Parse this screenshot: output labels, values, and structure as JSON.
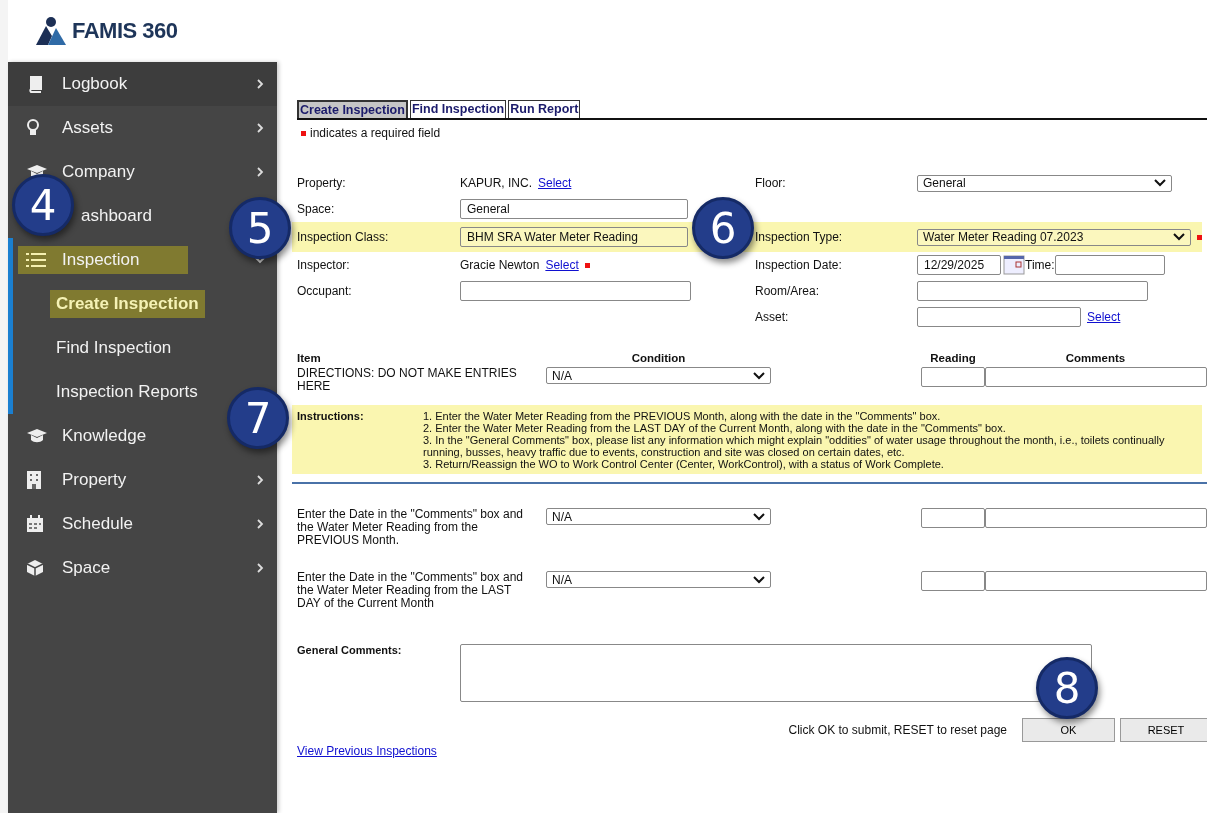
{
  "logo": {
    "text": "FAMIS 360"
  },
  "sidebar": {
    "items": [
      {
        "label": "Logbook",
        "chevron": true,
        "expanded": false,
        "selected": false
      },
      {
        "label": "Assets",
        "chevron": true,
        "expanded": false,
        "selected": false
      },
      {
        "label": "Company",
        "chevron": true,
        "expanded": false,
        "selected": false
      },
      {
        "label": "ashboard",
        "chevron": false,
        "selected": false
      },
      {
        "label": "Inspection",
        "chevron": true,
        "expanded": true,
        "selected": true,
        "children": [
          {
            "label": "Create Inspection",
            "selected": true
          },
          {
            "label": "Find Inspection",
            "selected": false
          },
          {
            "label": "Inspection Reports",
            "selected": false
          }
        ]
      },
      {
        "label": "Knowledge",
        "chevron": false,
        "selected": false
      },
      {
        "label": "Property",
        "chevron": true,
        "expanded": false,
        "selected": false
      },
      {
        "label": "Schedule",
        "chevron": true,
        "expanded": false,
        "selected": false
      },
      {
        "label": "Space",
        "chevron": true,
        "expanded": false,
        "selected": false
      }
    ]
  },
  "tabs": [
    {
      "label": "Create Inspection",
      "selected": true
    },
    {
      "label": "Find Inspection",
      "selected": false
    },
    {
      "label": "Run Report",
      "selected": false
    }
  ],
  "required_note": "indicates a required field",
  "form": {
    "rows": [
      {
        "left": {
          "label": "Property:",
          "kind": "text",
          "value": "KAPUR, INC.",
          "link": "Select"
        },
        "right": {
          "label": "Floor:",
          "kind": "select",
          "value": "General"
        }
      },
      {
        "left": {
          "label": "Space:",
          "kind": "input",
          "value": "General"
        },
        "right": null
      },
      {
        "highlighted": true,
        "left": {
          "label": "Inspection Class:",
          "kind": "input",
          "value": "BHM SRA Water Meter Reading"
        },
        "right": {
          "label": "Inspection Type:",
          "kind": "select",
          "value": "Water Meter Reading 07.2023",
          "required": true
        }
      },
      {
        "left": {
          "label": "Inspector:",
          "kind": "text",
          "value": "Gracie Newton",
          "link": "Select",
          "required": true
        },
        "right": {
          "label": "Inspection Date:",
          "kind": "date",
          "value": "12/29/2025",
          "time_label": "Time:"
        }
      },
      {
        "left": {
          "label": "Occupant:",
          "kind": "input"
        },
        "right": {
          "label": "Room/Area:",
          "kind": "input"
        }
      },
      {
        "left": null,
        "right": {
          "label": "Asset:",
          "kind": "input",
          "link": "Select"
        }
      }
    ]
  },
  "checklist": {
    "columns": [
      "Item",
      "Condition",
      "Reading",
      "Comments"
    ],
    "rows": [
      {
        "kind": "item",
        "item": "DIRECTIONS: DO NOT MAKE ENTRIES HERE",
        "condition": "N/A"
      },
      {
        "kind": "instructions",
        "label": "Instructions:",
        "lines": [
          "1. Enter the Water Meter Reading from the PREVIOUS Month, along with the date in the \"Comments\" box.",
          "2. Enter the Water Meter Reading from the LAST DAY of the Current Month, along with the date in the \"Comments\" box.",
          "3. In the \"General Comments\" box, please list any information which might explain \"oddities\" of water usage throughout the month, i.e., toilets continually running, busses, heavy traffic due to events, construction and site was closed on certain dates, etc.",
          "3. Return/Reassign the WO to Work Control Center (Center, WorkControl), with a status of Work Complete."
        ]
      },
      {
        "kind": "item",
        "item": "Enter the Date in the \"Comments\" box and the Water Meter Reading from the PREVIOUS Month.",
        "condition": "N/A"
      },
      {
        "kind": "item",
        "item": "Enter the Date in the \"Comments\" box and the Water Meter Reading from the LAST DAY of the Current Month",
        "condition": "N/A"
      }
    ]
  },
  "general_comments": {
    "label": "General Comments:"
  },
  "footer": {
    "hint": "Click OK to submit, RESET to reset page",
    "buttons": [
      "OK",
      "RESET"
    ],
    "link": "View Previous Inspections"
  },
  "callouts": [
    {
      "number": "4"
    },
    {
      "number": "5"
    },
    {
      "number": "6"
    },
    {
      "number": "7"
    },
    {
      "number": "8"
    }
  ]
}
